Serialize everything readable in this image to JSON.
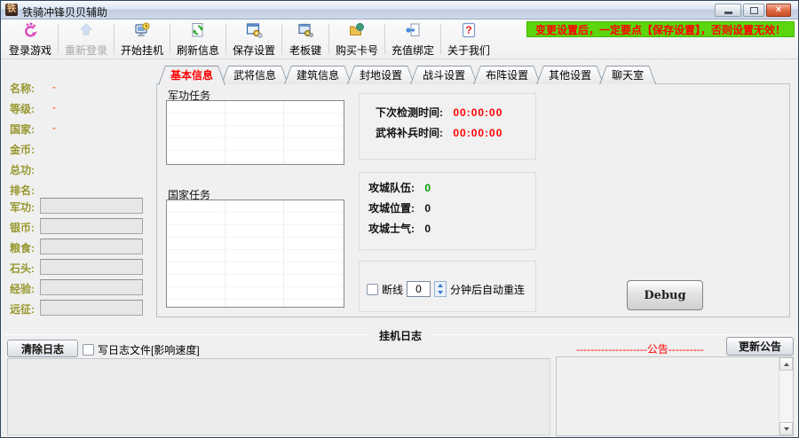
{
  "window": {
    "title": "铁骑冲锋贝贝辅助",
    "icon_glyph": "铁",
    "close_glyph": "×"
  },
  "toolbar": {
    "buttons": [
      {
        "label": "登录游戏",
        "icon": "login-game-icon",
        "enabled": true
      },
      {
        "label": "重新登录",
        "icon": "relogin-icon",
        "enabled": false
      },
      {
        "label": "开始挂机",
        "icon": "start-hangup-icon",
        "enabled": true
      },
      {
        "label": "刷新信息",
        "icon": "refresh-info-icon",
        "enabled": true
      },
      {
        "label": "保存设置",
        "icon": "save-settings-icon",
        "enabled": true
      },
      {
        "label": "老板键",
        "icon": "boss-key-icon",
        "enabled": true
      },
      {
        "label": "购买卡号",
        "icon": "buy-card-icon",
        "enabled": true
      },
      {
        "label": "充值绑定",
        "icon": "recharge-bind-icon",
        "enabled": true
      },
      {
        "label": "关于我们",
        "icon": "about-us-icon",
        "enabled": true
      }
    ],
    "notice": "变更设置后，一定要点【保存设置】，否则设置无效！"
  },
  "sidebar": {
    "stats": [
      {
        "label": "名称:",
        "value": "-"
      },
      {
        "label": "等级:",
        "value": "-"
      },
      {
        "label": "国家:",
        "value": "-"
      },
      {
        "label": "金币:",
        "value": ""
      },
      {
        "label": "总功:",
        "value": ""
      },
      {
        "label": "排名:",
        "value": ""
      }
    ],
    "fields": [
      {
        "label": "军功:",
        "value": ""
      },
      {
        "label": "银币:",
        "value": ""
      },
      {
        "label": "粮食:",
        "value": ""
      },
      {
        "label": "石头:",
        "value": ""
      },
      {
        "label": "经验:",
        "value": ""
      },
      {
        "label": "远征:",
        "value": ""
      }
    ]
  },
  "tabs": [
    {
      "label": "基本信息",
      "active": true
    },
    {
      "label": "武将信息",
      "active": false
    },
    {
      "label": "建筑信息",
      "active": false
    },
    {
      "label": "封地设置",
      "active": false
    },
    {
      "label": "战斗设置",
      "active": false
    },
    {
      "label": "布阵设置",
      "active": false
    },
    {
      "label": "其他设置",
      "active": false
    },
    {
      "label": "聊天室",
      "active": false
    }
  ],
  "content": {
    "groups": [
      {
        "title": "军功任务"
      },
      {
        "title": "国家任务"
      }
    ],
    "timers": [
      {
        "label": "下次检测时间:",
        "value": "00:00:00"
      },
      {
        "label": "武将补兵时间:",
        "value": "00:00:00"
      }
    ],
    "siege": [
      {
        "label": "攻城队伍:",
        "value": "0"
      },
      {
        "label": "攻城位置:",
        "value": "0"
      },
      {
        "label": "攻城士气:",
        "value": "0"
      }
    ],
    "reconnect": {
      "label": "断线",
      "minutes": "0",
      "suffix": "分钟后自动重连"
    },
    "debug_label": "Debug"
  },
  "bottom": {
    "log_title": "挂机日志",
    "clear_log_button": "清除日志",
    "write_log_label": "写日志文件[影响速度]",
    "announce_line": "--------------------公告----------",
    "update_announce_button": "更新公告"
  },
  "colors": {
    "notice_bg": "#5cd60e",
    "notice_text": "#ff0000",
    "active_tab_text": "#ff0000",
    "timer_value_text": "#ff0000",
    "siege_team_value_text": "#009900",
    "sidebar_label_text": "#97972e",
    "sidebar_dash_text": "#ff7f3f",
    "announce_text": "#ff0000"
  }
}
